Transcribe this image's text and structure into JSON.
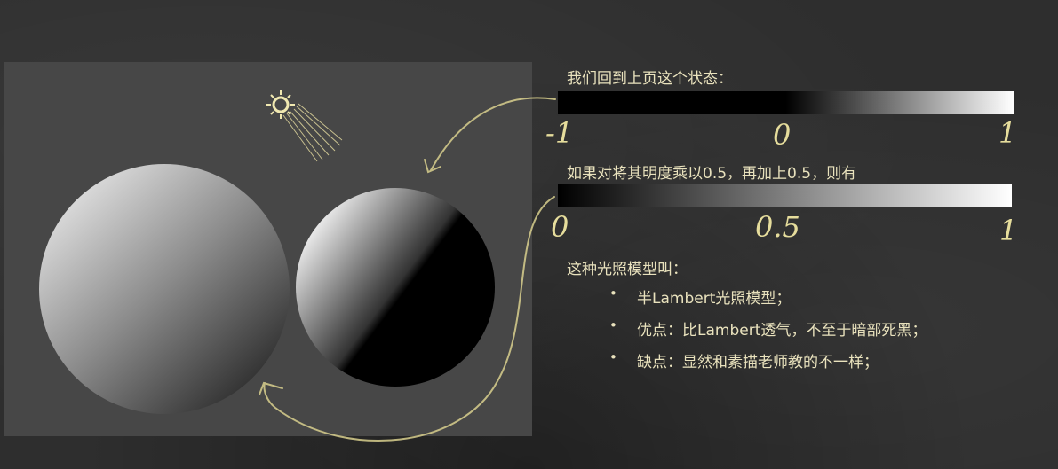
{
  "state_heading": "我们回到上页这个状态：",
  "scale1": {
    "left": "-1",
    "mid": "0",
    "right": "1"
  },
  "half_heading": "如果对将其明度乘以0.5，再加上0.5，则有",
  "scale2": {
    "left": "0",
    "mid": "0.5",
    "right": "1"
  },
  "model_heading": "这种光照模型叫：",
  "bullets": [
    {
      "text": "半Lambert光照模型；"
    },
    {
      "text": "优点：比Lambert透气，不至于暗部死黑；"
    },
    {
      "text": "缺点：显然和素描老师教的不一样；"
    }
  ],
  "colors": {
    "chalk_text": "#e9e2bd",
    "chalk_yellow": "#e6dd9c",
    "scene_bg": "#474747"
  }
}
